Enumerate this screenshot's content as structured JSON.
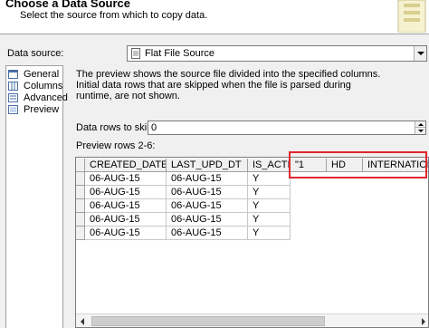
{
  "header": {
    "title": "Choose a Data Source",
    "subtitle": "Select the source from which to copy data."
  },
  "data_source": {
    "label": "Data source:",
    "value": "Flat File Source"
  },
  "nav": {
    "items": [
      {
        "label": "General",
        "icon": "general-icon"
      },
      {
        "label": "Columns",
        "icon": "columns-icon"
      },
      {
        "label": "Advanced",
        "icon": "advanced-icon"
      },
      {
        "label": "Preview",
        "icon": "preview-icon",
        "selected": true
      }
    ]
  },
  "preview": {
    "description": "The preview shows the source file divided into the specified columns. Initial data rows that are skipped when the file is parsed during runtime, are not shown.",
    "skip_label": "Data rows to skip:",
    "skip_value": "0",
    "rows_label": "Preview rows 2-6:"
  },
  "grid": {
    "columns": [
      "CREATED_DATE",
      "LAST_UPD_DT",
      "IS_ACTIVE",
      "\"1",
      "HD",
      "INTERNATIONA"
    ],
    "rows": [
      [
        "06-AUG-15",
        "06-AUG-15",
        "Y",
        "",
        "",
        ""
      ],
      [
        "06-AUG-15",
        "06-AUG-15",
        "Y",
        "",
        "",
        ""
      ],
      [
        "06-AUG-15",
        "06-AUG-15",
        "Y",
        "",
        "",
        ""
      ],
      [
        "06-AUG-15",
        "06-AUG-15",
        "Y",
        "",
        "",
        ""
      ],
      [
        "06-AUG-15",
        "06-AUG-15",
        "Y",
        "",
        "",
        ""
      ]
    ]
  },
  "colors": {
    "highlight": "#e0262b"
  }
}
